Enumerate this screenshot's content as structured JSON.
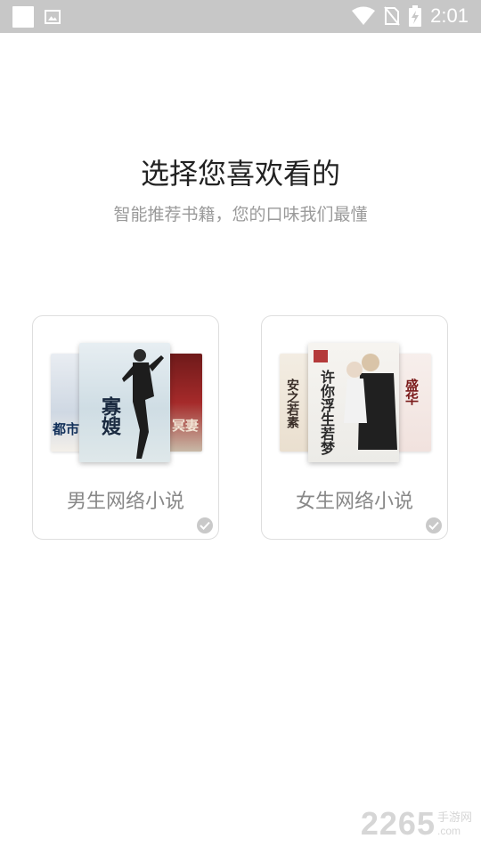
{
  "status_bar": {
    "time": "2:01",
    "icons": [
      "notification-square-icon",
      "image-notification-icon",
      "wifi-icon",
      "no-sim-icon",
      "battery-charging-icon"
    ]
  },
  "heading": {
    "title": "选择您喜欢看的",
    "subtitle": "智能推荐书籍，您的口味我们最懂"
  },
  "cards": [
    {
      "label": "男生网络小说",
      "covers": {
        "left": "都市",
        "front": "寡嫂",
        "right": "冥妻"
      }
    },
    {
      "label": "女生网络小说",
      "covers": {
        "left": "安之若素",
        "front": "许你浮生若梦",
        "right": "盛华"
      }
    }
  ],
  "watermark": {
    "number": "2265",
    "text": "手游网",
    "domain": ".com"
  },
  "colors": {
    "status_bar": "#c7c7c7",
    "title": "#222222",
    "subtitle": "#9a9a9a",
    "card_border": "#dedede",
    "label": "#888888"
  }
}
